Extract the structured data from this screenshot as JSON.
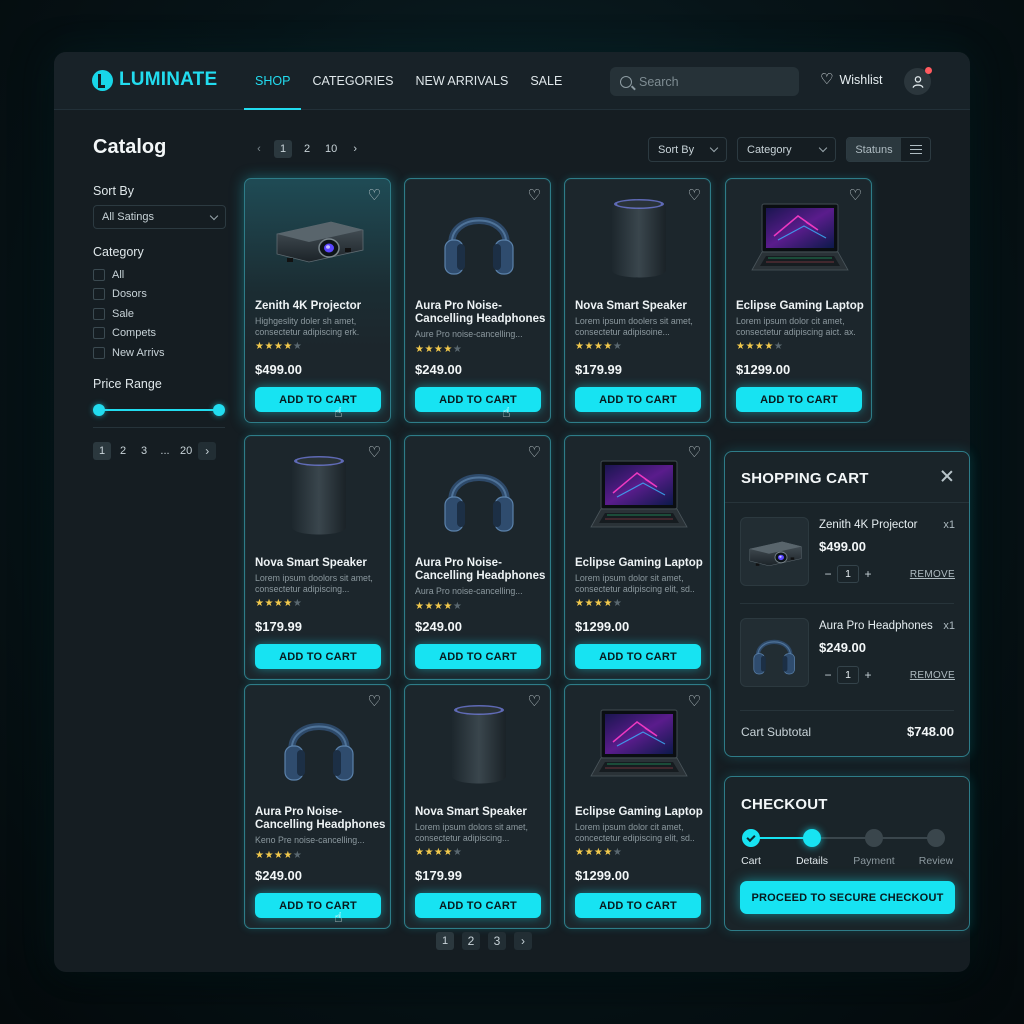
{
  "brand": {
    "name": "LUMINATE"
  },
  "nav": {
    "items": [
      {
        "label": "SHOP",
        "active": true
      },
      {
        "label": "CATEGORIES",
        "active": false
      },
      {
        "label": "NEW ARRIVALS",
        "active": false
      },
      {
        "label": "SALE",
        "active": false
      }
    ],
    "search_placeholder": "Search",
    "wishlist_label": "Wishlist"
  },
  "sidebar": {
    "title": "Catalog",
    "sort_by_label": "Sort By",
    "sort_by_value": "All Satings",
    "category_label": "Category",
    "categories": [
      "All",
      "Dosors",
      "Sale",
      "Compets",
      "New Arrivs"
    ],
    "price_range_label": "Price Range",
    "price_range": {
      "min_fraction": 0.0,
      "max_fraction": 1.0
    },
    "pager": [
      "1",
      "2",
      "3",
      "...",
      "20"
    ],
    "pager_next": "›"
  },
  "toolbar": {
    "pager": [
      "1",
      "2",
      "10"
    ],
    "pager_prev": "‹",
    "pager_next": "›",
    "sort_by": "Sort By",
    "category": "Category",
    "view_status": "Statuns"
  },
  "products": [
    {
      "name": "Zenith 4K Projector",
      "desc": "Highgeslity doler sh amet, consectetur adipiscing erk.",
      "rating": 4,
      "price": "$499.00",
      "button": "ADD TO CART",
      "kind": "projector"
    },
    {
      "name": "Aura Pro Noise-Cancelling Headphones",
      "desc": "Aure Pro noise-cancelling...",
      "rating": 4,
      "price": "$249.00",
      "button": "ADD TO CART",
      "kind": "headphones"
    },
    {
      "name": "Nova Smart Speaker",
      "desc": "Lorem ipsum doolers sit amet, consectetur adipisoine...",
      "rating": 4,
      "price": "$179.99",
      "button": "ADD TO CART",
      "kind": "speaker"
    },
    {
      "name": "Eclipse Gaming Laptop",
      "desc": "Lorem ipsum dolor cit amet, consectetur adipiscing aict. ax.",
      "rating": 4,
      "price": "$1299.00",
      "button": "ADD TO CART",
      "kind": "laptop"
    },
    {
      "name": "Nova Smart Speaker",
      "desc": "Lorem ipsum doolors sit amet, consectetur adipiscing...",
      "rating": 4,
      "price": "$179.99",
      "button": "ADD TO CART",
      "kind": "speaker"
    },
    {
      "name": "Aura Pro Noise-Cancelling Headphones",
      "desc": "Aura Pro noise-cancelling...",
      "rating": 4,
      "price": "$249.00",
      "button": "ADD TO CART",
      "kind": "headphones"
    },
    {
      "name": "Eclipse Gaming Laptop",
      "desc": "Lorem ipsum dolor sit amet, consectetur adipiscing elit, sd..",
      "rating": 4,
      "price": "$1299.00",
      "button": "ADD TO CART",
      "kind": "laptop"
    },
    {
      "name": "Aura Pro Noise-Cancelling Headphones",
      "desc": "Keno Pre noise-cancelling...",
      "rating": 4,
      "price": "$249.00",
      "button": "ADD TO CART",
      "kind": "headphones"
    },
    {
      "name": "Nova Smart Speaker",
      "desc": "Lorem ipsum dolors sit amet, consectetur adipiscing...",
      "rating": 4,
      "price": "$179.99",
      "button": "ADD TO CART",
      "kind": "speaker"
    },
    {
      "name": "Eclipse Gaming Laptop",
      "desc": "Lorem ipsum dolor cit amet, concectetur edipiscing elit, sd..",
      "rating": 4,
      "price": "$1299.00",
      "button": "ADD TO CART",
      "kind": "laptop"
    }
  ],
  "bottom_pager": [
    "1",
    "2",
    "3"
  ],
  "bottom_pager_next": "›",
  "cart": {
    "title": "SHOPPING CART",
    "items": [
      {
        "name": "Zenith 4K Projector",
        "qty_label": "x1",
        "price": "$499.00",
        "qty": "1",
        "remove": "REMOVE",
        "kind": "projector"
      },
      {
        "name": "Aura Pro Headphones",
        "qty_label": "x1",
        "price": "$249.00",
        "qty": "1",
        "remove": "REMOVE",
        "kind": "headphones"
      }
    ],
    "subtotal_label": "Cart Subtotal",
    "subtotal": "$748.00"
  },
  "checkout": {
    "title": "CHECKOUT",
    "steps": [
      {
        "label": "Cart",
        "state": "done"
      },
      {
        "label": "Details",
        "state": "current"
      },
      {
        "label": "Payment",
        "state": "todo"
      },
      {
        "label": "Review",
        "state": "todo"
      }
    ],
    "button": "PROCEED TO SECURE CHECKOUT"
  },
  "colors": {
    "accent": "#17e3f2",
    "panel": "#1a2429",
    "background": "#151d22",
    "star": "#f2c94c"
  }
}
